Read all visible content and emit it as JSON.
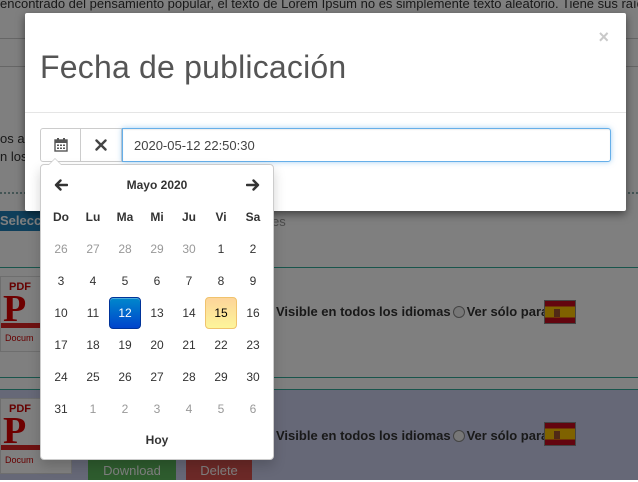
{
  "background": {
    "top_text": "encontrado del pensamiento popular, el texto de Lorem Ipsum no es simplemente texto aleatorio. Tiene sus raíces",
    "left_text_1": "os ar",
    "left_text_2": "n los",
    "select_button_label": "Selecc",
    "section_text": "es",
    "files": [
      {
        "visible_all_label": "Visible en todos los idiomas",
        "visible_only_label": "Ver sólo para"
      },
      {
        "visible_all_label": "Visible en todos los idiomas",
        "visible_only_label": "Ver sólo para"
      }
    ],
    "pdf_tag": "PDF",
    "pdf_letter": "P",
    "pdf_doc_text": "Docum",
    "download_label": "Download",
    "delete_label": "Delete",
    "colors": {
      "download": "#5cb85c",
      "delete": "#d9534f",
      "select": "#1f7fb7"
    }
  },
  "modal": {
    "title": "Fecha de publicación",
    "close_symbol": "×",
    "calendar_button_icon": "calendar-icon",
    "clear_button_icon": "clear-x-icon",
    "date_value": "2020-05-12 22:50:30"
  },
  "calendar": {
    "month_label": "Mayo 2020",
    "prev_icon": "arrow-left-icon",
    "next_icon": "arrow-right-icon",
    "weekdays": [
      "Do",
      "Lu",
      "Ma",
      "Mi",
      "Ju",
      "Vi",
      "Sa"
    ],
    "days": [
      [
        "26",
        "muted"
      ],
      [
        "27",
        "muted"
      ],
      [
        "28",
        "muted"
      ],
      [
        "29",
        "muted"
      ],
      [
        "30",
        "muted"
      ],
      [
        "1",
        ""
      ],
      [
        "2",
        ""
      ],
      [
        "3",
        ""
      ],
      [
        "4",
        ""
      ],
      [
        "5",
        ""
      ],
      [
        "6",
        ""
      ],
      [
        "7",
        ""
      ],
      [
        "8",
        ""
      ],
      [
        "9",
        ""
      ],
      [
        "10",
        ""
      ],
      [
        "11",
        ""
      ],
      [
        "12",
        "selected"
      ],
      [
        "13",
        ""
      ],
      [
        "14",
        ""
      ],
      [
        "15",
        "today"
      ],
      [
        "16",
        ""
      ],
      [
        "17",
        ""
      ],
      [
        "18",
        ""
      ],
      [
        "19",
        ""
      ],
      [
        "20",
        ""
      ],
      [
        "21",
        ""
      ],
      [
        "22",
        ""
      ],
      [
        "23",
        ""
      ],
      [
        "24",
        ""
      ],
      [
        "25",
        ""
      ],
      [
        "26",
        ""
      ],
      [
        "27",
        ""
      ],
      [
        "28",
        ""
      ],
      [
        "29",
        ""
      ],
      [
        "30",
        ""
      ],
      [
        "31",
        ""
      ],
      [
        "1",
        "muted"
      ],
      [
        "2",
        "muted"
      ],
      [
        "3",
        "muted"
      ],
      [
        "4",
        "muted"
      ],
      [
        "5",
        "muted"
      ],
      [
        "6",
        "muted"
      ]
    ],
    "today_label": "Hoy",
    "colors": {
      "selected": "#0068c9",
      "today": "#fde49a"
    }
  }
}
